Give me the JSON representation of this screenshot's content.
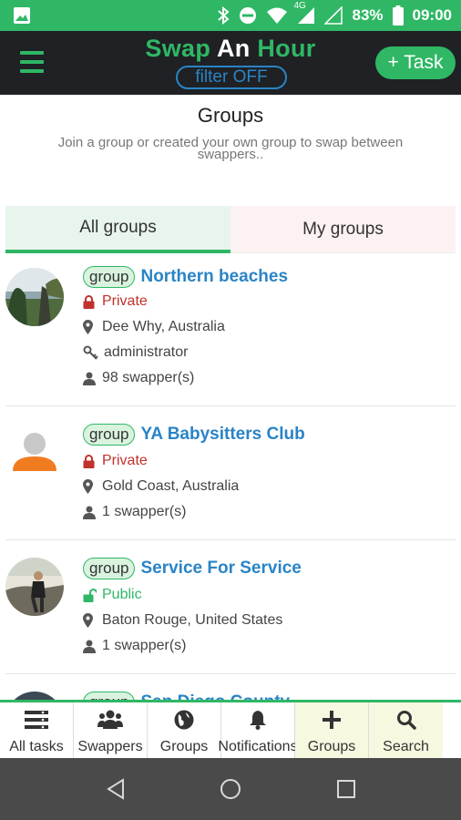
{
  "status_bar": {
    "battery": "83%",
    "time": "09:00",
    "network": "4G"
  },
  "app_bar": {
    "title_part1": "Swap",
    "title_part2": "An",
    "title_part3": "Hour",
    "filter_label": "filter OFF",
    "task_button": "+ Task"
  },
  "header": {
    "title": "Groups",
    "subtitle": "Join a group or created your own group to swap between swappers.."
  },
  "tabs": [
    {
      "label": "All groups",
      "active": true
    },
    {
      "label": "My groups",
      "active": false
    }
  ],
  "groups": [
    {
      "badge": "group",
      "name": "Northern beaches",
      "privacy": "Private",
      "location": "Dee Why, Australia",
      "role": "administrator",
      "members": "98 swapper(s)"
    },
    {
      "badge": "group",
      "name": "YA Babysitters Club",
      "privacy": "Private",
      "location": "Gold Coast, Australia",
      "members": "1 swapper(s)"
    },
    {
      "badge": "group",
      "name": "Service For Service",
      "privacy": "Public",
      "location": "Baton Rouge, United States",
      "members": "1 swapper(s)"
    },
    {
      "badge": "group",
      "name": "San Diego County"
    }
  ],
  "bottom_nav": [
    {
      "label": "All tasks",
      "icon": "list-icon"
    },
    {
      "label": "Swappers",
      "icon": "people-icon"
    },
    {
      "label": "Groups",
      "icon": "globe-icon"
    },
    {
      "label": "Notifications",
      "icon": "bell-icon"
    },
    {
      "label": "Groups",
      "icon": "plus-icon"
    },
    {
      "label": "Search",
      "icon": "search-icon"
    }
  ],
  "colors": {
    "brand_green": "#2fb765",
    "link_blue": "#2a84c6",
    "private_red": "#c0322b",
    "appbar_bg": "#1f2124"
  }
}
